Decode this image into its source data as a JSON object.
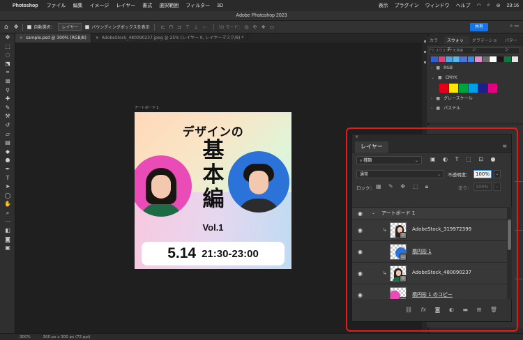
{
  "menubar": {
    "app": "Photoshop",
    "items": [
      "ファイル",
      "編集",
      "イメージ",
      "レイヤー",
      "書式",
      "選択範囲",
      "フィルター",
      "3D"
    ],
    "right_items": [
      "表示",
      "プラグイン",
      "ウィンドウ",
      "ヘルプ"
    ],
    "clock": "23:16"
  },
  "window": {
    "title": "Adobe Photoshop 2023"
  },
  "options": {
    "auto_select_label": "自動選択：",
    "auto_select_value": "レイヤー",
    "bounding_box_label": "バウンディングボックスを表示",
    "mode_3d": "3D モード：",
    "share_label": "共有"
  },
  "doc_tabs": [
    {
      "label": "sample.psd @ 300% (RGB/8)",
      "active": true
    },
    {
      "label": "AdobeStock_480090237.jpeg @ 25% (レイヤー 0, レイヤーマスク/8) *",
      "active": false
    }
  ],
  "artboard": {
    "label": "アートボード 1",
    "title_line1": "デザインの",
    "title_line2": "基本編",
    "vol": "Vol.1",
    "date": "5.14",
    "time": "21:30-23:00"
  },
  "statusbar": {
    "zoom": "300%",
    "info": "300 px x 300 px (72 ppi)"
  },
  "swatches_panel": {
    "tabs": [
      "カラー",
      "スウォッチ",
      "グラデーション",
      "パターン"
    ],
    "active_tab": 1,
    "search_placeholder": "スウォッチを検索",
    "recent_colors": [
      "#2f5fd6",
      "#e0407a",
      "#4aa7e2",
      "#59b8e8",
      "#4f72e0",
      "#3f85f0",
      "#e08fcf",
      "#6a6a6a",
      "#ffffff",
      "#1a1a1a",
      "#0c7a3e",
      "#e6e6e6"
    ],
    "folders": [
      {
        "label": "RGB",
        "expanded": false
      },
      {
        "label": "CMYK",
        "expanded": true
      },
      {
        "label": "グレースケール",
        "expanded": false
      },
      {
        "label": "パステル",
        "expanded": false
      }
    ],
    "cmyk_colors": [
      "#e3001b",
      "#ffe600",
      "#00a23b",
      "#00a0e9",
      "#1d2088",
      "#e4007f"
    ]
  },
  "layers_panel": {
    "tab": "レイヤー",
    "filter_kind": "種類",
    "blend_mode": "通常",
    "opacity_label": "不透明度：",
    "opacity_value": "100%",
    "lock_label": "ロック：",
    "fill_label": "塗り：",
    "fill_value": "100%",
    "group_name": "アートボード 1",
    "layers": [
      {
        "name": "AdobeStock_319972399",
        "kind": "photo-clipped"
      },
      {
        "name": "楕円形 1",
        "kind": "shape-blue"
      },
      {
        "name": "AdobeStock_480090237",
        "kind": "photo-clipped"
      },
      {
        "name": "楕円形 1 のコピー",
        "kind": "shape-pink"
      }
    ]
  },
  "colors": {
    "accent": "#1473e6",
    "annotation": "#e21d1d"
  }
}
